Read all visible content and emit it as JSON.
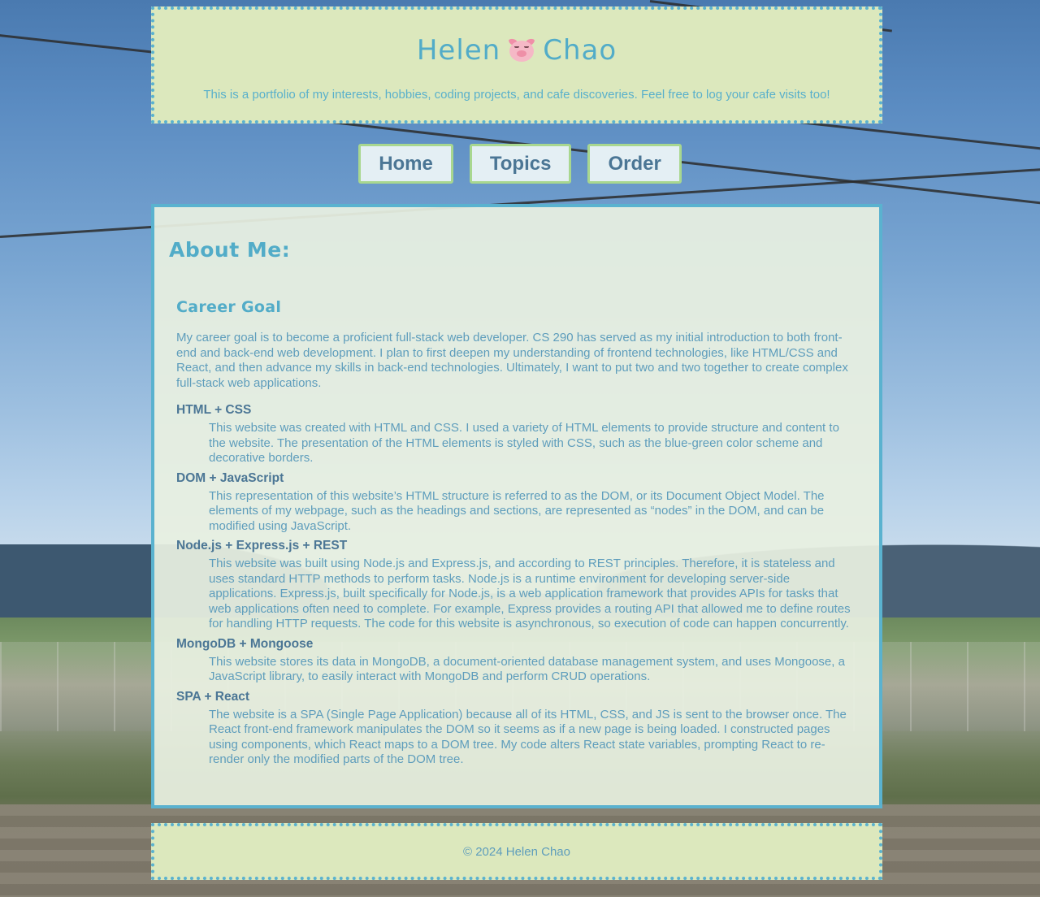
{
  "header": {
    "title_first": "Helen",
    "title_last": "Chao",
    "title_icon": "pig-face-icon",
    "tagline": "This is a portfolio of my interests, hobbies, coding projects, and cafe discoveries. Feel free to log your cafe visits too!"
  },
  "nav": {
    "items": [
      {
        "label": "Home"
      },
      {
        "label": "Topics"
      },
      {
        "label": "Order"
      }
    ]
  },
  "main": {
    "title": "About Me:",
    "section": {
      "title": "Career Goal",
      "intro": "My career goal is to become a proficient full-stack web developer. CS 290 has served as my initial introduction to both front-end and back-end web development. I plan to first deepen my understanding of frontend technologies, like HTML/CSS and React, and then advance my skills in back-end technologies. Ultimately, I want to put two and two together to create complex full-stack web applications.",
      "topics": [
        {
          "term": "HTML + CSS",
          "desc": "This website was created with HTML and CSS. I used a variety of HTML elements to provide structure and content to the website. The presentation of the HTML elements is styled with CSS, such as the blue-green color scheme and decorative borders."
        },
        {
          "term": "DOM + JavaScript",
          "desc": "This representation of this website’s HTML structure is referred to as the DOM, or its Document Object Model. The elements of my webpage, such as the headings and sections, are represented as “nodes” in the DOM, and can be modified using JavaScript."
        },
        {
          "term": "Node.js + Express.js + REST",
          "desc": "This website was built using Node.js and Express.js, and according to REST principles. Therefore, it is stateless and uses standard HTTP methods to perform tasks. Node.js is a runtime environment for developing server-side applications. Express.js, built specifically for Node.js, is a web application framework that provides APIs for tasks that web applications often need to complete. For example, Express provides a routing API that allowed me to define routes for handling HTTP requests. The code for this website is asynchronous, so execution of code can happen concurrently."
        },
        {
          "term": "MongoDB + Mongoose",
          "desc": "This website stores its data in MongoDB, a document-oriented database management system, and uses Mongoose, a JavaScript library, to easily interact with MongoDB and perform CRUD operations."
        },
        {
          "term": "SPA + React",
          "desc": "The website is a SPA (Single Page Application) because all of its HTML, CSS, and JS is sent to the browser once. The React front-end framework manipulates the DOM so it seems as if a new page is being loaded. I constructed pages using components, which React maps to a DOM tree. My code alters React state variables, prompting React to re-render only the modified parts of the DOM tree."
        }
      ]
    }
  },
  "footer": {
    "text": "© 2024 Helen Chao"
  },
  "colors": {
    "accent": "#52acc8",
    "panel": "#dce8bd",
    "nav_border": "#a8d78f",
    "nav_text": "#4b7695"
  }
}
